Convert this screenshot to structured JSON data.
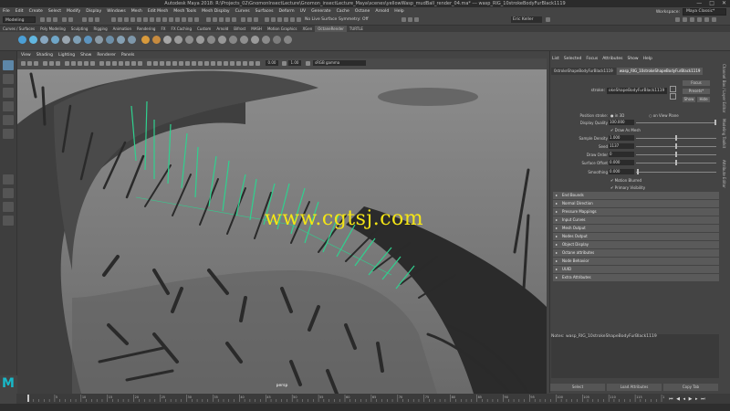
{
  "window": {
    "title": "Autodesk Maya 2018: R:\\Projects_02\\GnomonInsectLecture\\Gnomon_insectLecture_Maya\\scenes\\yellowWasp_mudBall_render_04.ma*  ---  wasp_RIG_10strokeBodyFurBlack1119",
    "controls": [
      "—",
      "□",
      "✕"
    ]
  },
  "menubar": {
    "items": [
      "File",
      "Edit",
      "Create",
      "Select",
      "Modify",
      "Display",
      "Windows",
      "Mesh",
      "Edit Mesh",
      "Mesh Tools",
      "Mesh Display",
      "Curves",
      "Surfaces",
      "Deform",
      "UV",
      "Generate",
      "Cache",
      "Octane",
      "Arnold",
      "Help"
    ],
    "workspace_label": "Workspace:",
    "workspace_value": "Maya Classic*"
  },
  "statusline": {
    "mode": "Modeling",
    "live_surface": "No Live Surface",
    "symmetry": "Symmetry: Off",
    "user": "Eric Keller"
  },
  "shelf": {
    "tabs": [
      "Curves / Surfaces",
      "Poly Modeling",
      "Sculpting",
      "Rigging",
      "Animation",
      "Rendering",
      "FX",
      "FX Caching",
      "Custom",
      "Arnold",
      "Bifrost",
      "MASH",
      "Motion Graphics",
      "XGen",
      "OctaneRender",
      "TURTLE"
    ],
    "active_tab": "OctaneRender"
  },
  "viewport": {
    "menu": [
      "View",
      "Shading",
      "Lighting",
      "Show",
      "Renderer",
      "Panels"
    ],
    "exposure": "0.00",
    "gamma": "1.00",
    "colorspace": "sRGB gamma",
    "camera_label": "persp",
    "watermark": "www.cgtsj.com"
  },
  "attribute_editor": {
    "menu": [
      "List",
      "Selected",
      "Focus",
      "Attributes",
      "Show",
      "Help"
    ],
    "tabs": [
      "0strokeShapeBodyFurBlack1119",
      "wasp_RIG_10strokeShapeBodyFurBlack1119"
    ],
    "stroke_label": "stroke:",
    "stroke_value": "okeShapeBodyFurBlack1119",
    "buttons": {
      "focus": "Focus",
      "presets": "Presets*",
      "show": "Show",
      "hide": "Hide"
    },
    "position_label": "Position stroke:",
    "position_opt1": "in 3D",
    "position_opt2": "on View Plane",
    "display_quality_label": "Display Quality",
    "display_quality": "100.000",
    "draw_as_mesh": "Draw As Mesh",
    "attrs": [
      {
        "label": "Sample Density",
        "value": "1.000"
      },
      {
        "label": "Seed",
        "value": "1137"
      },
      {
        "label": "Draw Order",
        "value": "0"
      },
      {
        "label": "Surface Offset",
        "value": "0.000"
      },
      {
        "label": "Smoothing",
        "value": "0.000"
      }
    ],
    "motion_blurred": "Motion Blurred",
    "primary_visibility": "Primary Visibility",
    "sections": [
      "End Bounds",
      "Normal Direction",
      "Pressure Mappings",
      "Input Curves",
      "Mesh Output",
      "Nodes Output",
      "Object Display",
      "Octane attributes",
      "Node Behavior",
      "UUID",
      "Extra Attributes"
    ],
    "notes": "Notes:  wasp_RIG_10strokeShapeBodyFurBlack1119",
    "bottom_buttons": [
      "Select",
      "Load Attributes",
      "Copy Tab"
    ]
  },
  "side_tabs": [
    "Channel Box / Layer Editor",
    "Modeling Toolkit",
    "Attribute Editor"
  ],
  "timeslider": {
    "ticks": [
      "5",
      "10",
      "15",
      "20",
      "25",
      "30",
      "35",
      "40",
      "45",
      "50",
      "55",
      "60",
      "65",
      "70",
      "75",
      "80",
      "85",
      "90",
      "95",
      "100",
      "105",
      "110",
      "115",
      "120"
    ],
    "current_frame": "1"
  },
  "logo": "M",
  "colors": {
    "accent_green": "#2fd18f",
    "watermark_yellow": "#f4e516",
    "maya_blue": "#18b8c8",
    "active_tool": "#5d87a8"
  }
}
